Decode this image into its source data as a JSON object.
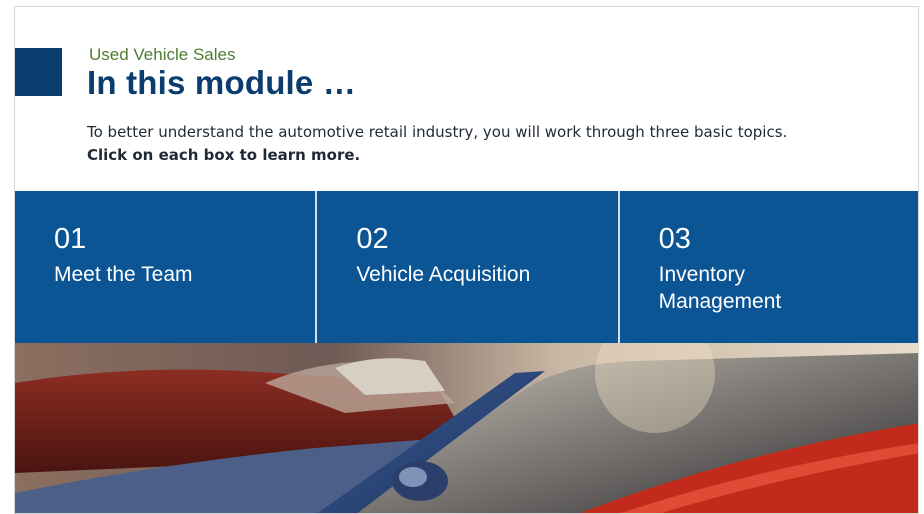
{
  "header": {
    "subtitle": "Used Vehicle Sales",
    "title": "In this module …",
    "intro_text": "To better understand the automotive retail industry, you will work through three basic topics. ",
    "intro_bold": "Click on each box to learn more."
  },
  "topics": [
    {
      "number": "01",
      "label": "Meet the Team"
    },
    {
      "number": "02",
      "label": "Vehicle Acquisition"
    },
    {
      "number": "03",
      "label": "Inventory Management"
    }
  ],
  "colors": {
    "accent_navy": "#0a3d6e",
    "topic_blue": "#0b5595",
    "subtitle_green": "#4e7d31"
  },
  "image": {
    "description_icon": "parked-cars-photo"
  }
}
